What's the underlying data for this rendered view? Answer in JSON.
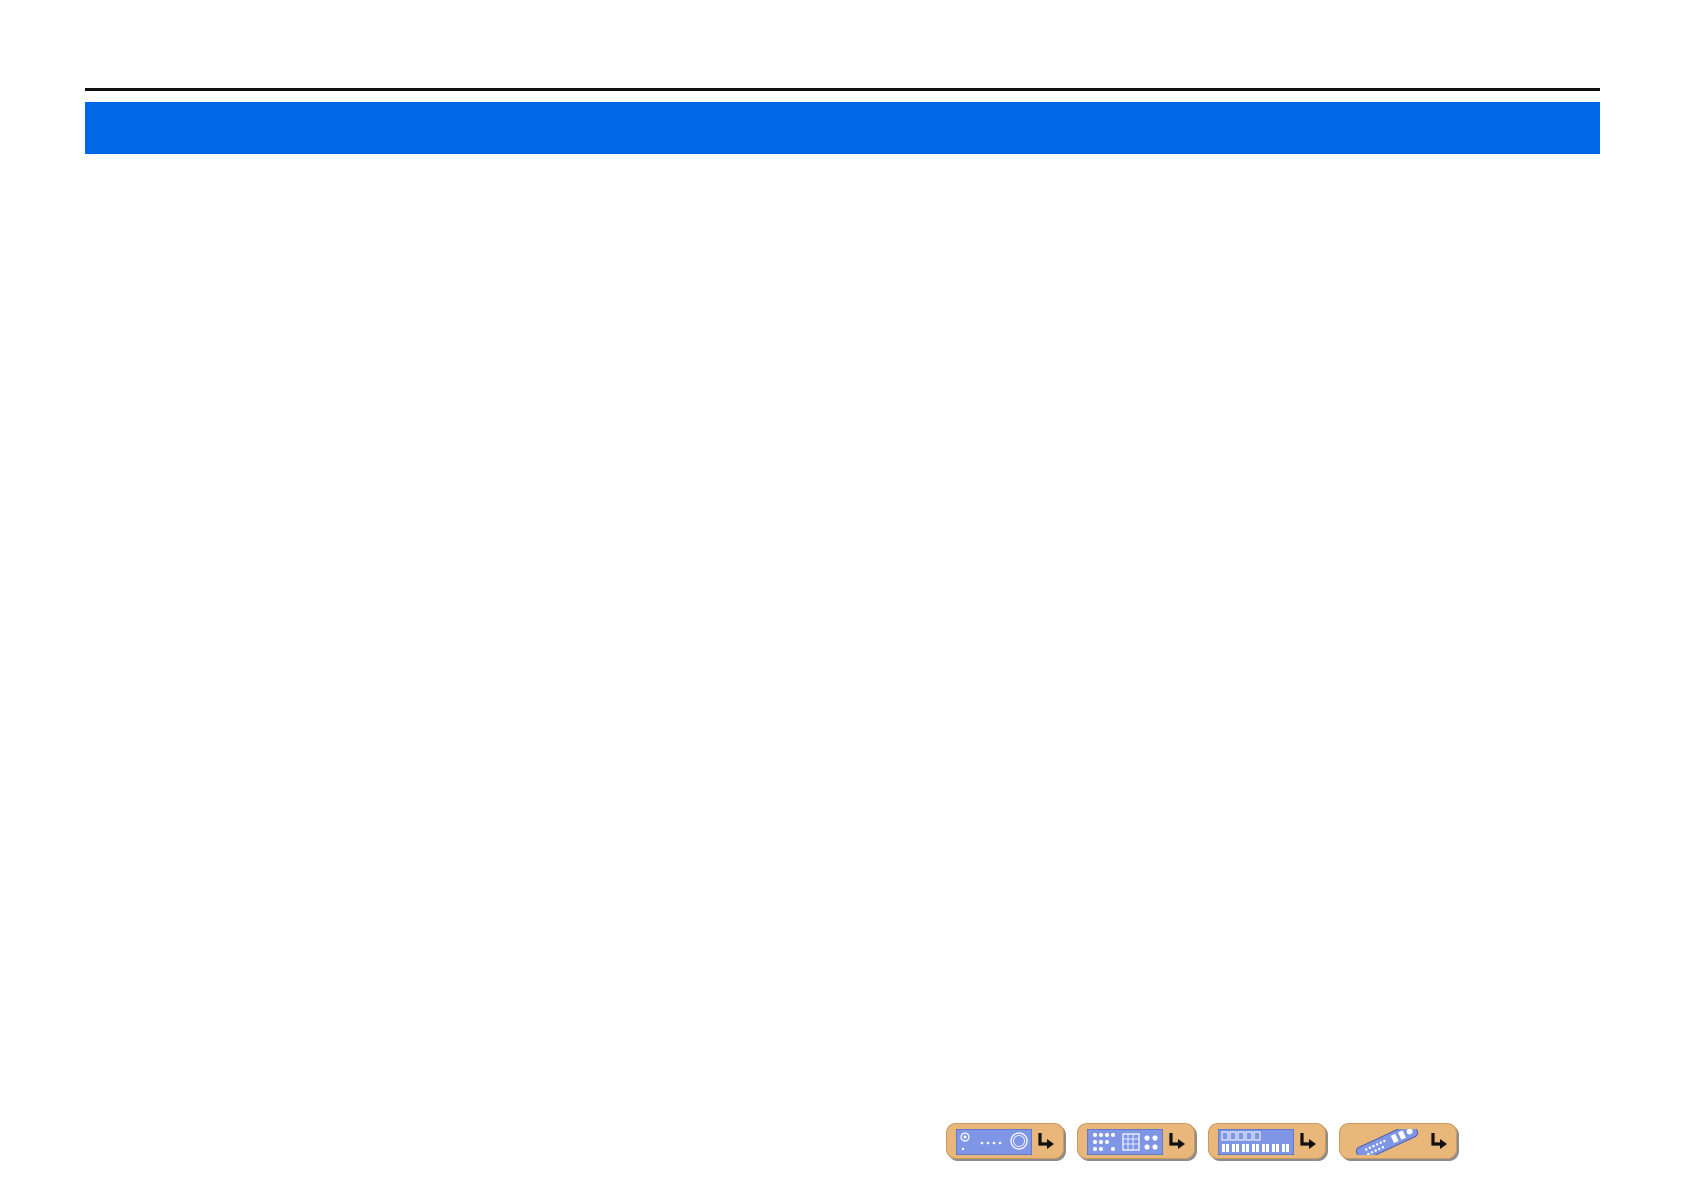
{
  "page": {
    "title": "",
    "accent_color": "#0067e6",
    "rule_color": "#111111"
  },
  "nav_buttons": [
    {
      "name": "front-panel",
      "icon": "front-panel-icon",
      "target_icon": "jump-arrow-icon"
    },
    {
      "name": "rear-panel",
      "icon": "rear-panel-icon",
      "target_icon": "jump-arrow-icon"
    },
    {
      "name": "front-display",
      "icon": "front-display-icon",
      "target_icon": "jump-arrow-icon"
    },
    {
      "name": "remote-control",
      "icon": "remote-control-icon",
      "target_icon": "jump-arrow-icon"
    }
  ],
  "nav_button_color": "#e9b77a",
  "icon_color": "#7f96e6"
}
